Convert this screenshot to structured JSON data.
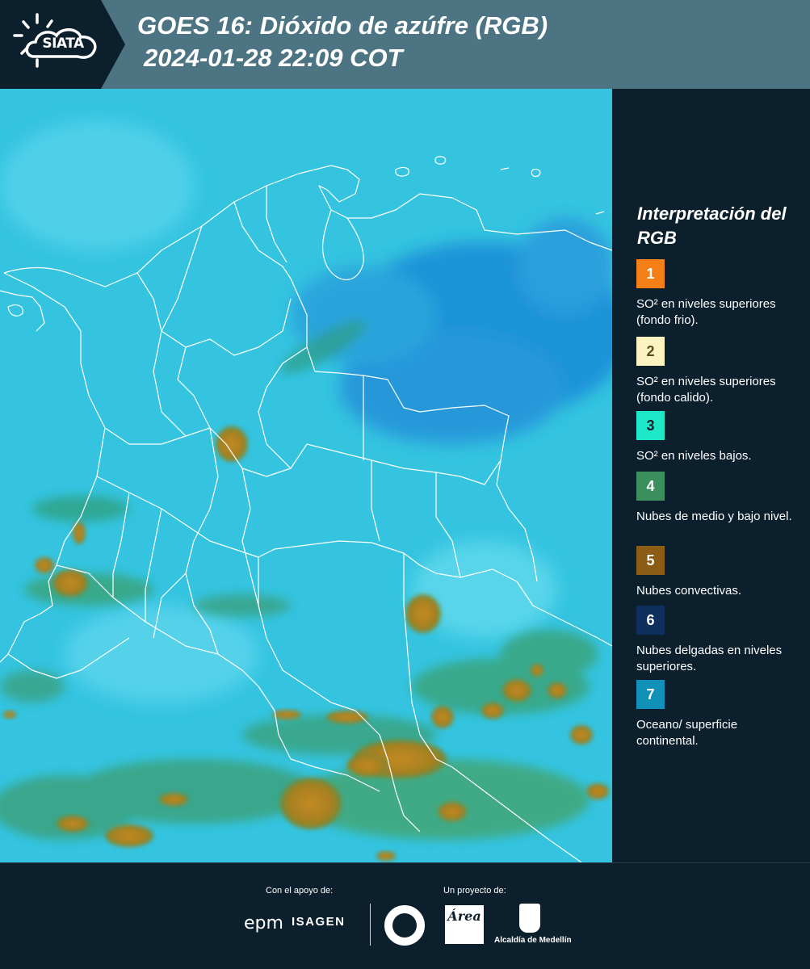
{
  "header": {
    "logo_text": "SIATA",
    "title_line1": "GOES 16: Dióxido de azúfre (RGB)",
    "title_line2": "2024-01-28 22:09 COT"
  },
  "legend": {
    "title": "Interpretación del RGB",
    "items": [
      {
        "number": "1",
        "color": "#f57f17",
        "text": "SO² en niveles superiores (fondo frio)."
      },
      {
        "number": "2",
        "color": "#fdf3c0",
        "text": "SO² en niveles superiores (fondo calido)."
      },
      {
        "number": "3",
        "color": "#1de9c8",
        "text": "SO² en niveles bajos."
      },
      {
        "number": "4",
        "color": "#3a8f5c",
        "text": "Nubes de medio y bajo nivel."
      },
      {
        "number": "5",
        "color": "#8a5c14",
        "text": "Nubes convectivas."
      },
      {
        "number": "6",
        "color": "#0f2f5e",
        "text": "Nubes delgadas en niveles superiores."
      },
      {
        "number": "7",
        "color": "#1191b8",
        "text": "Oceano/ superficie continental."
      }
    ]
  },
  "footer": {
    "support_label": "Con el apoyo de:",
    "project_label": "Un proyecto de:",
    "sponsor_epm": "epm",
    "sponsor_isagen": "ISAGEN",
    "partner_area": "Área",
    "partner_alcaldia": "Alcaldía de Medellín"
  },
  "colors": {
    "header_bg": "#4d7482",
    "logo_bg": "#0c1f2c",
    "panel_bg": "#0c1f2c",
    "ocean_cyan": "#33c3e0",
    "continental_blue": "#1a8fd6",
    "convective_brown": "#a8801f",
    "low_cloud_green": "#3aa070",
    "border_white": "#ffffff"
  }
}
